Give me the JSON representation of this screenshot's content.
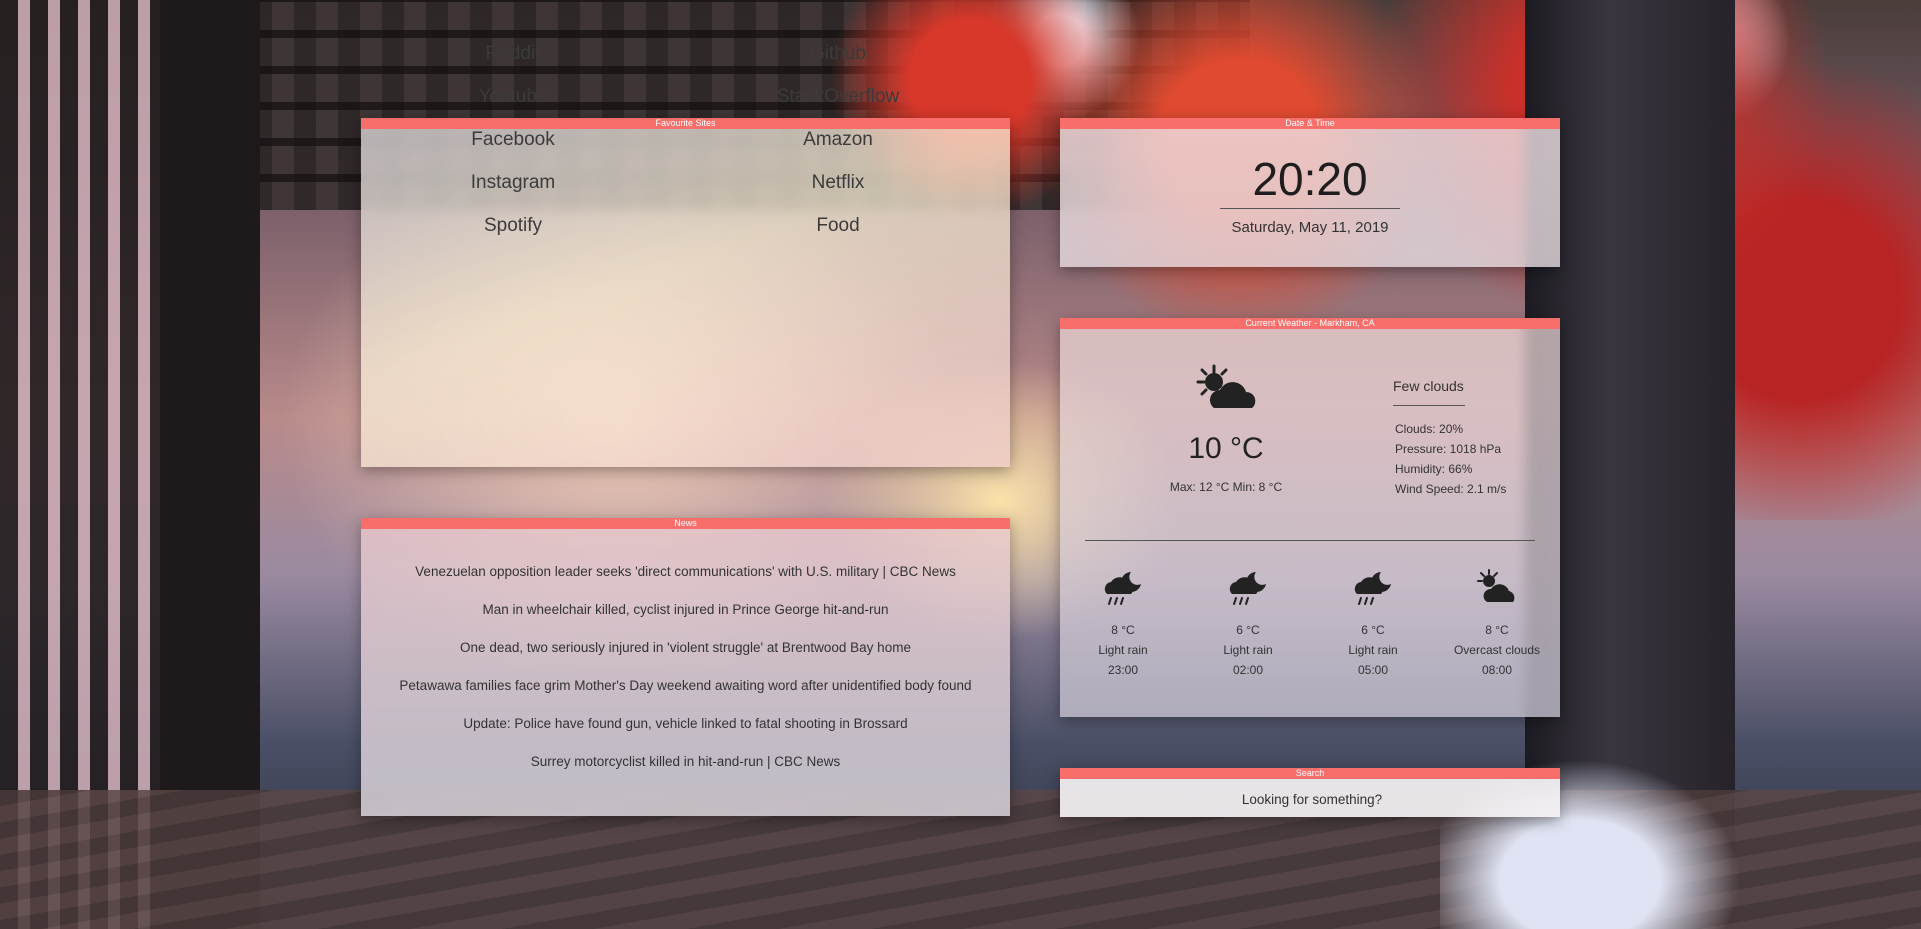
{
  "favourites": {
    "header": "Favourite Sites",
    "left": [
      "Reddit",
      "Youtube",
      "Facebook",
      "Instagram",
      "Spotify"
    ],
    "right": [
      "Github",
      "StackOverflow",
      "Amazon",
      "Netflix",
      "Food"
    ]
  },
  "news": {
    "header": "News",
    "items": [
      "Venezuelan opposition leader seeks 'direct communications' with U.S. military | CBC News",
      "Man in wheelchair killed, cyclist injured in Prince George hit-and-run",
      "One dead, two seriously injured in 'violent struggle' at Brentwood Bay home",
      "Petawawa families face grim Mother's Day weekend awaiting word after unidentified body found",
      "Update: Police have found gun, vehicle linked to fatal shooting in Brossard",
      "Surrey motorcyclist killed in hit-and-run | CBC News"
    ]
  },
  "datetime": {
    "header": "Date & Time",
    "time": "20:20",
    "date": "Saturday, May 11, 2019"
  },
  "weather": {
    "header": "Current Weather - Markham, CA",
    "icon": "partly-cloudy-day-icon",
    "temp": "10 °C",
    "range": "Max: 12 °C   Min: 8 °C",
    "description": "Few clouds",
    "details": [
      "Clouds: 20%",
      "Pressure: 1018 hPa",
      "Humidity: 66%",
      "Wind Speed: 2.1 m/s"
    ],
    "forecast": [
      {
        "temp": "8 °C",
        "desc": "Light rain",
        "time": "23:00",
        "icon": "rain-night-icon"
      },
      {
        "temp": "6 °C",
        "desc": "Light rain",
        "time": "02:00",
        "icon": "rain-night-icon"
      },
      {
        "temp": "6 °C",
        "desc": "Light rain",
        "time": "05:00",
        "icon": "rain-night-icon"
      },
      {
        "temp": "8 °C",
        "desc": "Overcast clouds",
        "time": "08:00",
        "icon": "partly-cloudy-day-icon"
      }
    ]
  },
  "search": {
    "header": "Search",
    "placeholder": "Looking for something?"
  },
  "colors": {
    "accent": "#f76e6a"
  }
}
